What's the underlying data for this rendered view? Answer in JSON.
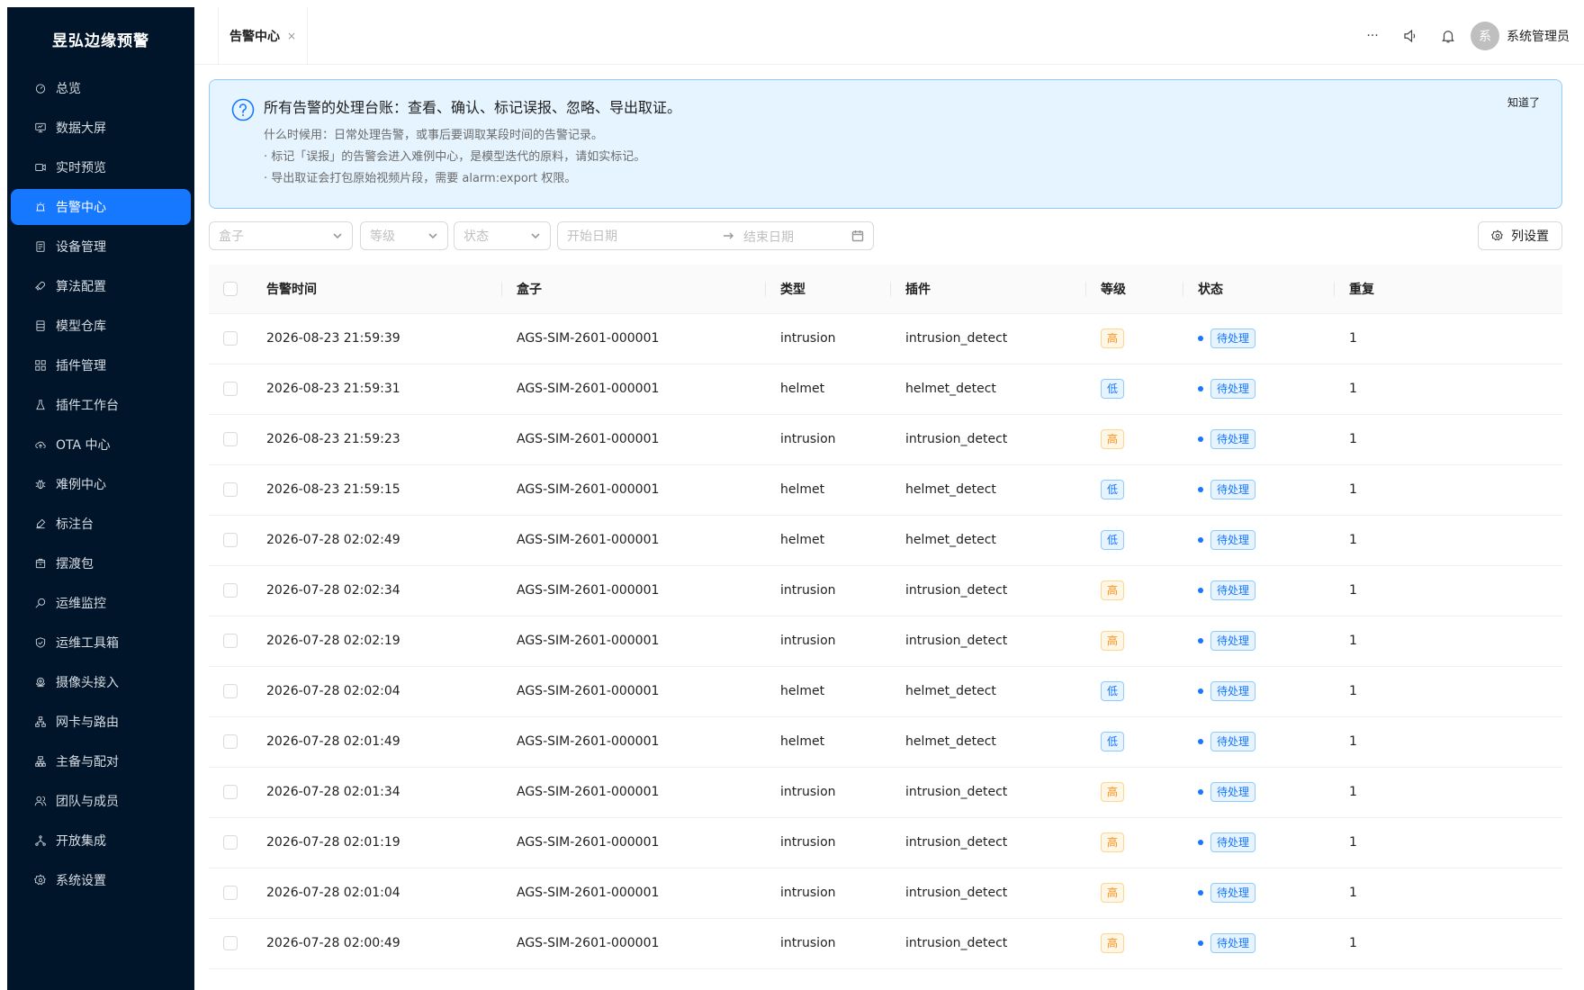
{
  "app": {
    "brand": "昱弘边缘预警"
  },
  "sidebar": {
    "items": [
      {
        "label": "总览",
        "icon": "dashboard-icon",
        "active": false
      },
      {
        "label": "数据大屏",
        "icon": "monitor-icon",
        "active": false
      },
      {
        "label": "实时预览",
        "icon": "video-camera-icon",
        "active": false
      },
      {
        "label": "告警中心",
        "icon": "alarm-icon",
        "active": true
      },
      {
        "label": "设备管理",
        "icon": "device-icon",
        "active": false
      },
      {
        "label": "算法配置",
        "icon": "rocket-icon",
        "active": false
      },
      {
        "label": "模型仓库",
        "icon": "database-icon",
        "active": false
      },
      {
        "label": "插件管理",
        "icon": "appstore-icon",
        "active": false
      },
      {
        "label": "插件工作台",
        "icon": "experiment-icon",
        "active": false
      },
      {
        "label": "OTA 中心",
        "icon": "cloud-upload-icon",
        "active": false
      },
      {
        "label": "难例中心",
        "icon": "bug-icon",
        "active": false
      },
      {
        "label": "标注台",
        "icon": "highlight-icon",
        "active": false
      },
      {
        "label": "摆渡包",
        "icon": "package-icon",
        "active": false
      },
      {
        "label": "运维监控",
        "icon": "file-search-icon",
        "active": false
      },
      {
        "label": "运维工具箱",
        "icon": "safety-icon",
        "active": false
      },
      {
        "label": "摄像头接入",
        "icon": "camera-icon",
        "active": false
      },
      {
        "label": "网卡与路由",
        "icon": "cluster-icon",
        "active": false
      },
      {
        "label": "主备与配对",
        "icon": "apartment-icon",
        "active": false
      },
      {
        "label": "团队与成员",
        "icon": "team-icon",
        "active": false
      },
      {
        "label": "开放集成",
        "icon": "deployment-icon",
        "active": false
      },
      {
        "label": "系统设置",
        "icon": "setting-icon",
        "active": false
      }
    ]
  },
  "header": {
    "tab_label": "告警中心",
    "tab_close": "×",
    "more": "···",
    "user_initial": "系",
    "user_name": "系统管理员"
  },
  "notice": {
    "title": "所有告警的处理台账：查看、确认、标记误报、忽略、导出取证。",
    "lines": [
      "什么时候用：日常处理告警，或事后要调取某段时间的告警记录。",
      "· 标记「误报」的告警会进入难例中心，是模型迭代的原料，请如实标记。",
      "· 导出取证会打包原始视频片段，需要 alarm:export 权限。"
    ],
    "close": "知道了"
  },
  "filters": {
    "box_placeholder": "盒子",
    "level_placeholder": "等级",
    "status_placeholder": "状态",
    "start_placeholder": "开始日期",
    "end_placeholder": "结束日期",
    "columns_button": "列设置"
  },
  "table": {
    "headers": [
      "告警时间",
      "盒子",
      "类型",
      "插件",
      "等级",
      "状态",
      "重复"
    ],
    "rows": [
      {
        "time": "2026-08-23 21:59:39",
        "box": "AGS-SIM-2601-000001",
        "type": "intrusion",
        "plugin": "intrusion_detect",
        "level": "高",
        "level_kind": "high",
        "status": "待处理",
        "repeat": "1"
      },
      {
        "time": "2026-08-23 21:59:31",
        "box": "AGS-SIM-2601-000001",
        "type": "helmet",
        "plugin": "helmet_detect",
        "level": "低",
        "level_kind": "low",
        "status": "待处理",
        "repeat": "1"
      },
      {
        "time": "2026-08-23 21:59:23",
        "box": "AGS-SIM-2601-000001",
        "type": "intrusion",
        "plugin": "intrusion_detect",
        "level": "高",
        "level_kind": "high",
        "status": "待处理",
        "repeat": "1"
      },
      {
        "time": "2026-08-23 21:59:15",
        "box": "AGS-SIM-2601-000001",
        "type": "helmet",
        "plugin": "helmet_detect",
        "level": "低",
        "level_kind": "low",
        "status": "待处理",
        "repeat": "1"
      },
      {
        "time": "2026-07-28 02:02:49",
        "box": "AGS-SIM-2601-000001",
        "type": "helmet",
        "plugin": "helmet_detect",
        "level": "低",
        "level_kind": "low",
        "status": "待处理",
        "repeat": "1"
      },
      {
        "time": "2026-07-28 02:02:34",
        "box": "AGS-SIM-2601-000001",
        "type": "intrusion",
        "plugin": "intrusion_detect",
        "level": "高",
        "level_kind": "high",
        "status": "待处理",
        "repeat": "1"
      },
      {
        "time": "2026-07-28 02:02:19",
        "box": "AGS-SIM-2601-000001",
        "type": "intrusion",
        "plugin": "intrusion_detect",
        "level": "高",
        "level_kind": "high",
        "status": "待处理",
        "repeat": "1"
      },
      {
        "time": "2026-07-28 02:02:04",
        "box": "AGS-SIM-2601-000001",
        "type": "helmet",
        "plugin": "helmet_detect",
        "level": "低",
        "level_kind": "low",
        "status": "待处理",
        "repeat": "1"
      },
      {
        "time": "2026-07-28 02:01:49",
        "box": "AGS-SIM-2601-000001",
        "type": "helmet",
        "plugin": "helmet_detect",
        "level": "低",
        "level_kind": "low",
        "status": "待处理",
        "repeat": "1"
      },
      {
        "time": "2026-07-28 02:01:34",
        "box": "AGS-SIM-2601-000001",
        "type": "intrusion",
        "plugin": "intrusion_detect",
        "level": "高",
        "level_kind": "high",
        "status": "待处理",
        "repeat": "1"
      },
      {
        "time": "2026-07-28 02:01:19",
        "box": "AGS-SIM-2601-000001",
        "type": "intrusion",
        "plugin": "intrusion_detect",
        "level": "高",
        "level_kind": "high",
        "status": "待处理",
        "repeat": "1"
      },
      {
        "time": "2026-07-28 02:01:04",
        "box": "AGS-SIM-2601-000001",
        "type": "intrusion",
        "plugin": "intrusion_detect",
        "level": "高",
        "level_kind": "high",
        "status": "待处理",
        "repeat": "1"
      },
      {
        "time": "2026-07-28 02:00:49",
        "box": "AGS-SIM-2601-000001",
        "type": "intrusion",
        "plugin": "intrusion_detect",
        "level": "高",
        "level_kind": "high",
        "status": "待处理",
        "repeat": "1"
      }
    ]
  },
  "colors": {
    "sidebar_bg": "#001529",
    "accent": "#1677ff",
    "high": "#fa8c16",
    "low": "#1677ff",
    "notice_bg": "#e6f4ff"
  }
}
